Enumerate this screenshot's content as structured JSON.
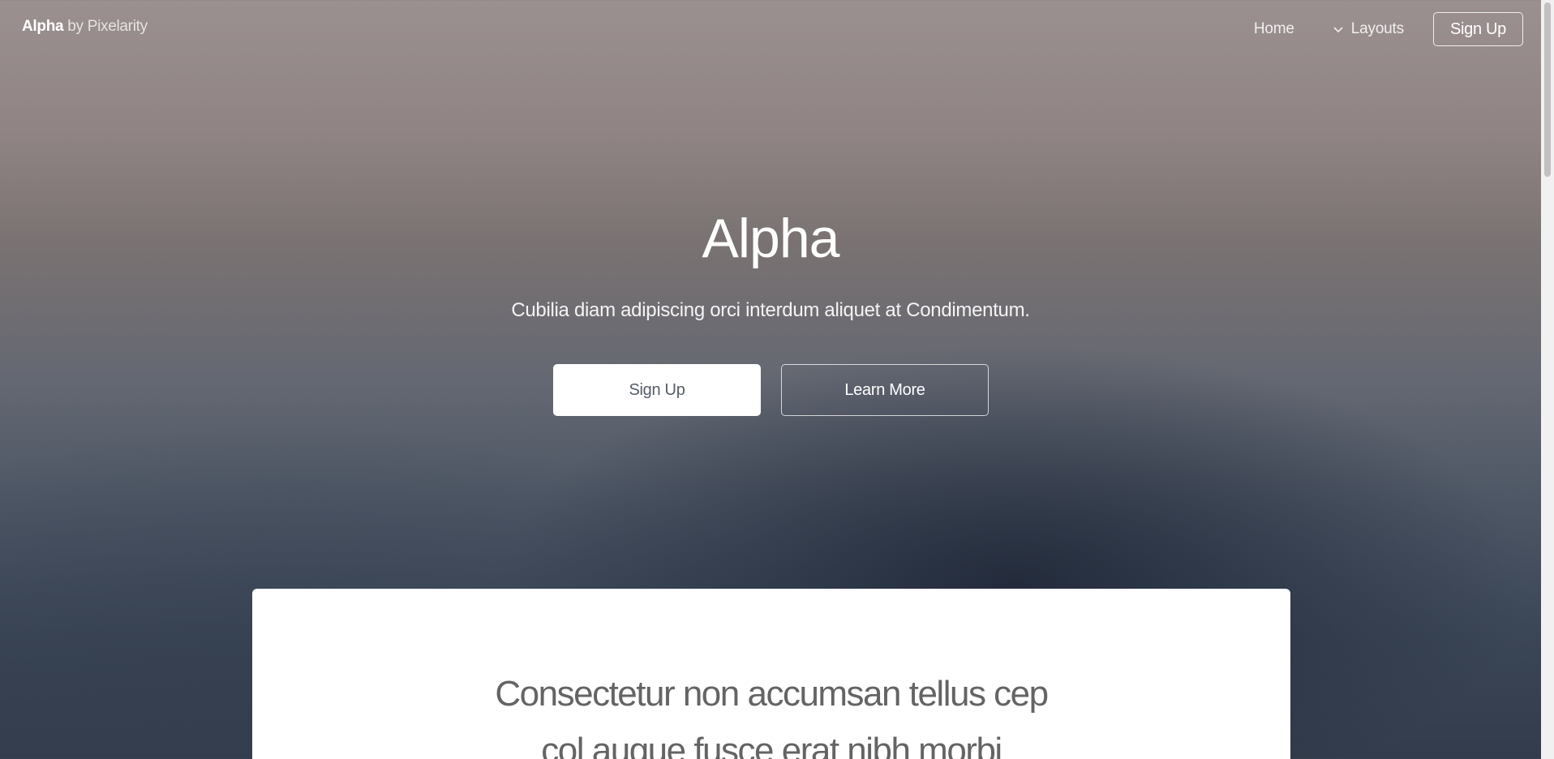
{
  "header": {
    "brand_name": "Alpha",
    "brand_by": "by Pixelarity",
    "nav": {
      "home": "Home",
      "layouts": "Layouts",
      "layouts_icon": "chevron-down-icon",
      "signup": "Sign Up"
    }
  },
  "hero": {
    "title": "Alpha",
    "subtitle": "Cubilia diam adipiscing orci interdum aliquet at Condimentum.",
    "buttons": {
      "primary": "Sign Up",
      "secondary": "Learn More"
    }
  },
  "main": {
    "intro_line_1": "Consectetur non accumsan tellus cep",
    "intro_line_2": "col augue fusce erat nibh morbi"
  },
  "colors": {
    "background_top": "#9b9090",
    "background_bottom": "#333c4c",
    "card_bg": "#ffffff",
    "card_text": "#646464",
    "primary_button_text": "#555c68"
  }
}
